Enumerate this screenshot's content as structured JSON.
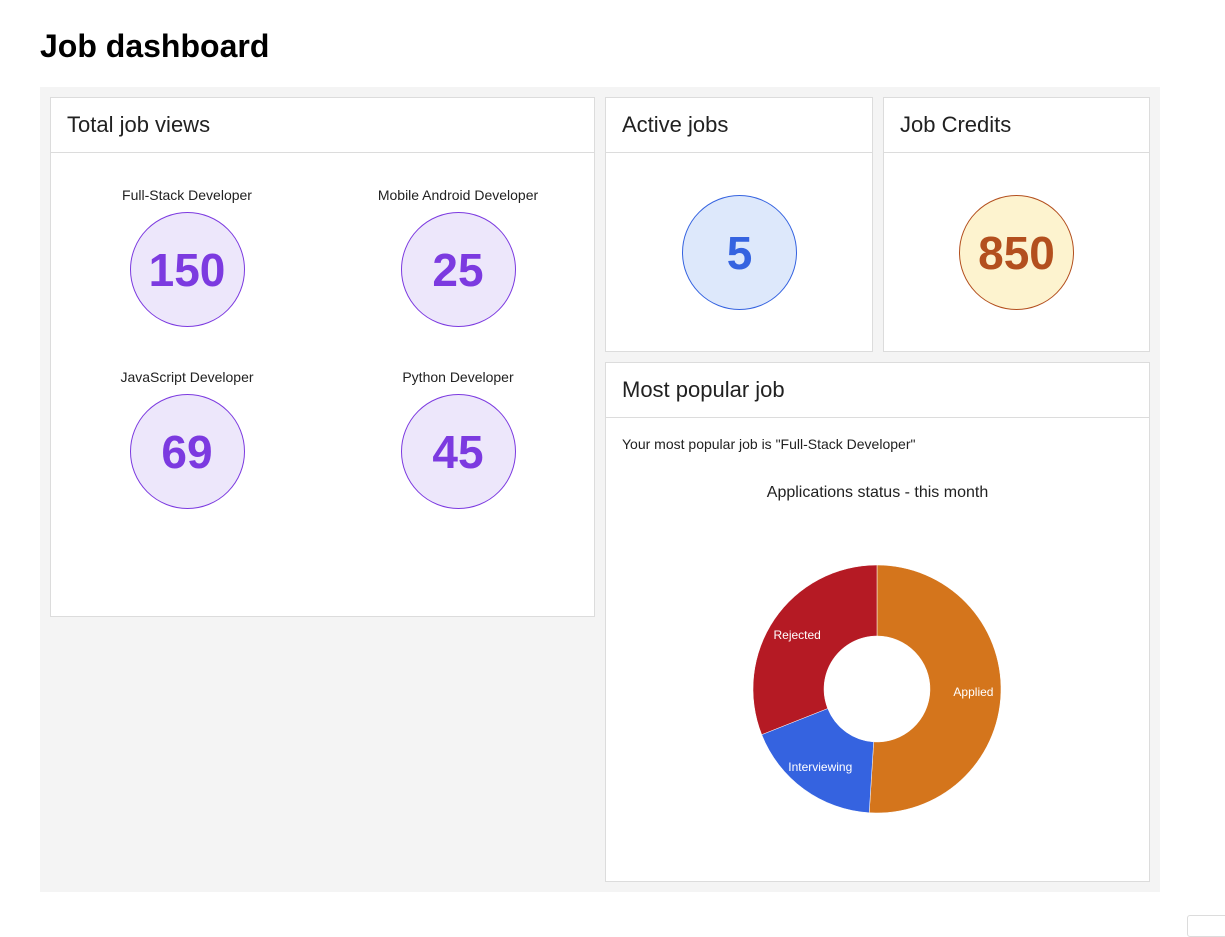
{
  "page": {
    "title": "Job dashboard"
  },
  "total_job_views": {
    "title": "Total job views",
    "items": [
      {
        "label": "Full-Stack Developer",
        "value": "150"
      },
      {
        "label": "Mobile Android Developer",
        "value": "25"
      },
      {
        "label": "JavaScript Developer",
        "value": "69"
      },
      {
        "label": "Python Developer",
        "value": "45"
      }
    ]
  },
  "active_jobs": {
    "title": "Active jobs",
    "value": "5"
  },
  "job_credits": {
    "title": "Job Credits",
    "value": "850"
  },
  "most_popular": {
    "title": "Most popular job",
    "text": "Your most popular job is \"Full-Stack Developer\""
  },
  "chart_data": {
    "type": "pie",
    "title": "Applications status - this month",
    "donut": true,
    "slices": [
      {
        "label": "Applied",
        "value": 51,
        "color": "#d4751c"
      },
      {
        "label": "Interviewing",
        "value": 18,
        "color": "#3563e0"
      },
      {
        "label": "Rejected",
        "value": 31,
        "color": "#b51a24"
      }
    ]
  }
}
